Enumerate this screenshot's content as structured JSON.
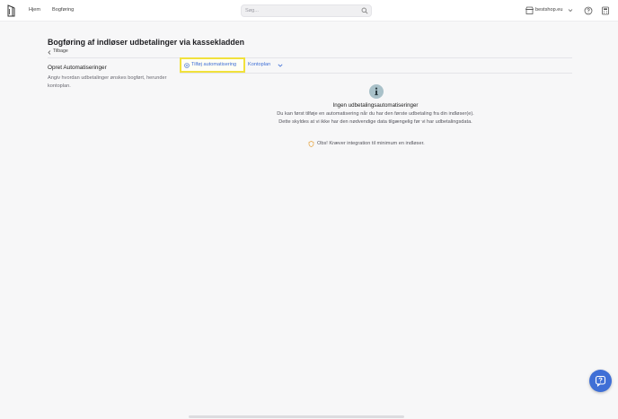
{
  "nav": {
    "home": "Hjem",
    "bookkeeping": "Bogføring"
  },
  "search": {
    "placeholder": "Søg...",
    "icon": "search-icon"
  },
  "header_right": {
    "shop_name": "bestshop.eu",
    "icons": [
      "shop-icon",
      "help-icon",
      "calculator-icon"
    ]
  },
  "page": {
    "title": "Bogføring af indløser udbetalinger via kassekladden",
    "back_label": "Tilbage"
  },
  "section": {
    "title": "Opret Automatiseringer",
    "description": "Angiv hvordan udbetalinger ønskes bogført, herunder kontoplan."
  },
  "toolbar": {
    "add_label": "Tilføj automatisering",
    "dropdown_label": "Kontoplan"
  },
  "empty_state": {
    "title": "Ingen udbetalingsautomatiseringer",
    "body": "Du kan først tilføje en automatisering når du har den første udbetaling fra din indløser(e). Dette skyldes at vi ikke har den nødvendige data tilgængelig før vi har udbetalingsdata.",
    "note": "Obs! Kræver integration til minimum en indløser."
  },
  "colors": {
    "accent": "#3f6fd6",
    "highlight": "#f1e13c",
    "warning": "#e6a23c",
    "info_circle": "#a9c1c9"
  }
}
